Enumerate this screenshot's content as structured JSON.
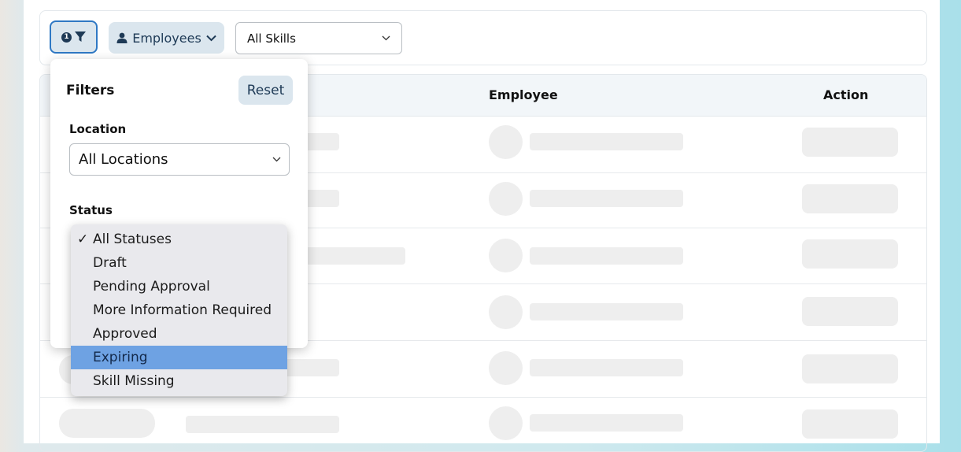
{
  "toolbar": {
    "filter_badge": "1",
    "employees_label": "Employees",
    "skills_select_value": "All Skills"
  },
  "table": {
    "columns": [
      "Employee",
      "Action"
    ]
  },
  "filters": {
    "title": "Filters",
    "reset_label": "Reset",
    "location_label": "Location",
    "location_value": "All Locations",
    "status_label": "Status",
    "status_options": [
      "All Statuses",
      "Draft",
      "Pending Approval",
      "More Information Required",
      "Approved",
      "Expiring",
      "Skill Missing"
    ],
    "status_checked": "All Statuses",
    "status_highlighted": "Expiring",
    "checkmark": "✓"
  },
  "colors": {
    "accent": "#2f78c4",
    "button_bg": "#dbe6ee",
    "text_dark": "#1e3a56",
    "highlight": "#6ea2e3"
  }
}
